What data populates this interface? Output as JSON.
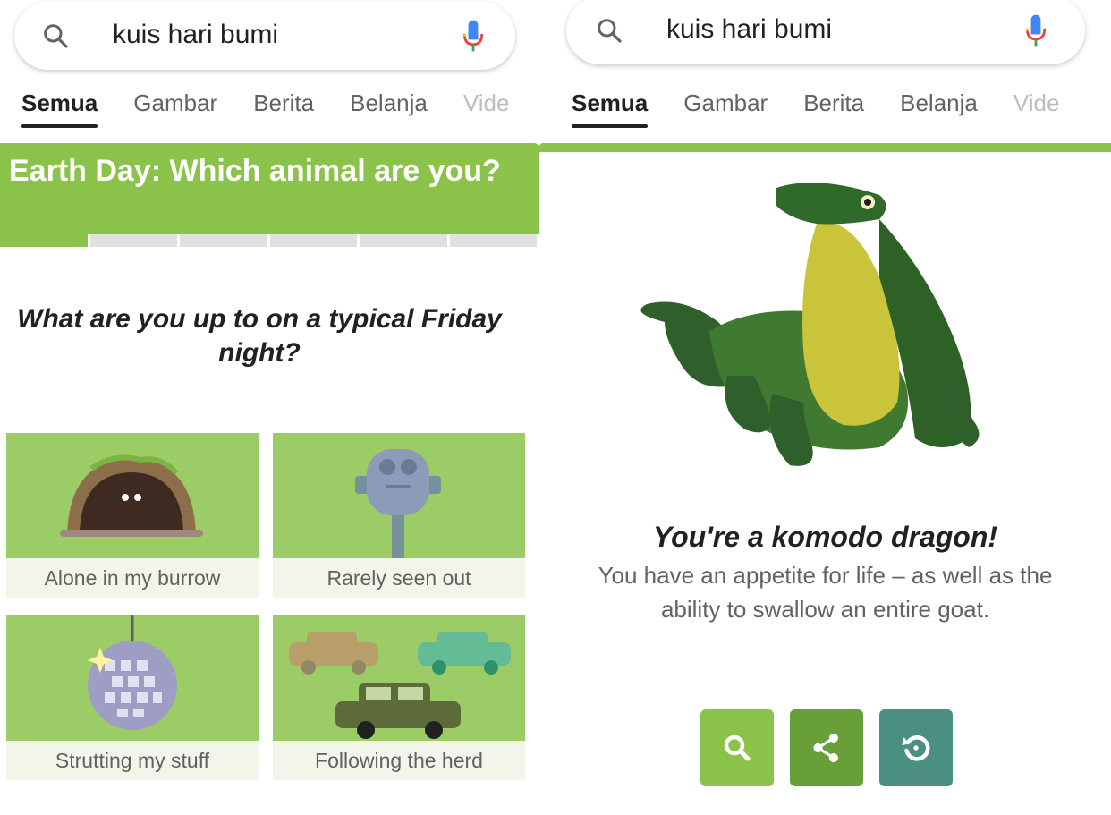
{
  "search": {
    "query": "kuis hari bumi"
  },
  "tabs": [
    "Semua",
    "Gambar",
    "Berita",
    "Belanja",
    "Vide"
  ],
  "quiz": {
    "title": "Earth Day: Which animal are you?",
    "progress_completed": 1,
    "progress_total": 6,
    "question": "What are you up to on a typical Friday night?",
    "answers": [
      {
        "label": "Alone in my burrow",
        "icon": "burrow-icon"
      },
      {
        "label": "Rarely seen out",
        "icon": "binocular-viewer-icon"
      },
      {
        "label": "Strutting my stuff",
        "icon": "disco-ball-icon"
      },
      {
        "label": "Following the herd",
        "icon": "cars-icon"
      }
    ]
  },
  "result": {
    "title": "You're a komodo dragon!",
    "description": "You have an appetite for life – as well as the ability to swallow an entire goat.",
    "image": "komodo-dragon-illustration"
  },
  "actions": [
    "search-icon",
    "share-icon",
    "restart-icon"
  ],
  "colors": {
    "accent_green": "#8bc34a",
    "card_green": "#9ccc65",
    "share_green": "#689f38",
    "restart_teal": "#4a8f80"
  }
}
